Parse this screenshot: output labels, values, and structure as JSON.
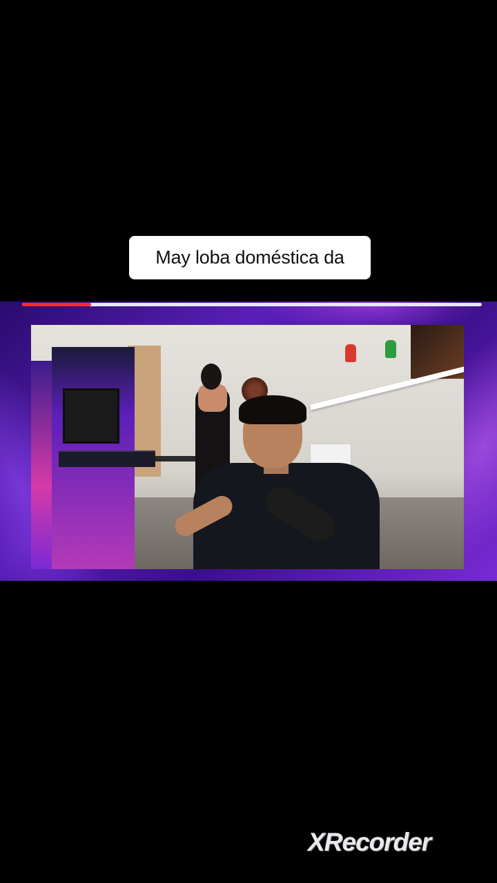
{
  "caption": {
    "text": "May loba doméstica da"
  },
  "video": {
    "progress_fraction": 0.15,
    "colors": {
      "progress_fill": "#ff2a2a",
      "progress_track": "#e8e8f0",
      "frame_accent": "#5a1fb8"
    }
  },
  "watermark": {
    "text": "XRecorder"
  }
}
